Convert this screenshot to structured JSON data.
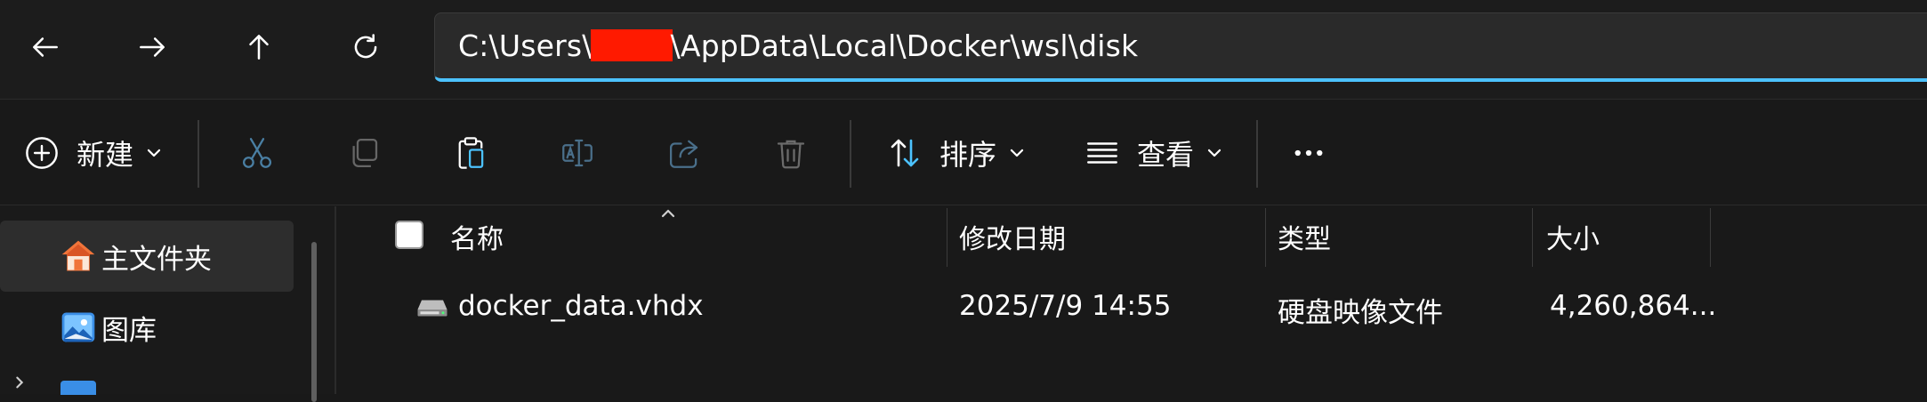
{
  "nav": {
    "back_icon": "arrow-left-icon",
    "forward_icon": "arrow-right-icon",
    "up_icon": "arrow-up-icon",
    "refresh_icon": "refresh-icon"
  },
  "address": {
    "path_prefix": "C:\\Users\\",
    "path_suffix": "\\AppData\\Local\\Docker\\wsl\\disk",
    "accent_color": "#4cc2ff",
    "redaction_color": "#ff1a00"
  },
  "toolbar": {
    "new_label": "新建",
    "sort_label": "排序",
    "view_label": "查看"
  },
  "sidebar": {
    "items": [
      {
        "label": "主文件夹",
        "icon": "home-icon",
        "selected": true
      },
      {
        "label": "图库",
        "icon": "gallery-icon",
        "selected": false
      }
    ]
  },
  "columns": {
    "name": "名称",
    "modified": "修改日期",
    "type": "类型",
    "size": "大小"
  },
  "files": [
    {
      "name": "docker_data.vhdx",
      "modified": "2025/7/9 14:55",
      "type": "硬盘映像文件",
      "size": "4,260,864..."
    }
  ]
}
